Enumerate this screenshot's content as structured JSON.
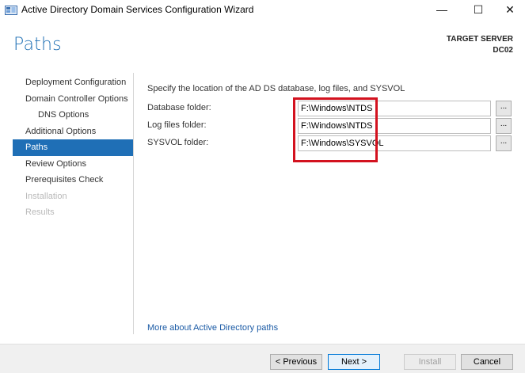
{
  "window": {
    "title": "Active Directory Domain Services Configuration Wizard",
    "minimize": "—",
    "maximize": "☐",
    "close": "✕"
  },
  "header": {
    "page_title": "Paths",
    "target_label": "TARGET SERVER",
    "target_name": "DC02"
  },
  "sidebar": {
    "items": [
      {
        "label": "Deployment Configuration",
        "state": "normal"
      },
      {
        "label": "Domain Controller Options",
        "state": "normal"
      },
      {
        "label": "DNS Options",
        "state": "sub"
      },
      {
        "label": "Additional Options",
        "state": "normal"
      },
      {
        "label": "Paths",
        "state": "active"
      },
      {
        "label": "Review Options",
        "state": "normal"
      },
      {
        "label": "Prerequisites Check",
        "state": "normal"
      },
      {
        "label": "Installation",
        "state": "disabled"
      },
      {
        "label": "Results",
        "state": "disabled"
      }
    ]
  },
  "main": {
    "intro": "Specify the location of the AD DS database, log files, and SYSVOL",
    "fields": [
      {
        "label": "Database folder:",
        "value": "F:\\Windows\\NTDS",
        "browse": "..."
      },
      {
        "label": "Log files folder:",
        "value": "F:\\Windows\\NTDS",
        "browse": "..."
      },
      {
        "label": "SYSVOL folder:",
        "value": "F:\\Windows\\SYSVOL",
        "browse": "..."
      }
    ],
    "more_link": "More about Active Directory paths"
  },
  "footer": {
    "previous": "< Previous",
    "next": "Next >",
    "install": "Install",
    "cancel": "Cancel"
  },
  "colors": {
    "accent": "#1f6fb6",
    "title_blue": "#1e6fb4",
    "highlight_red": "#d3121f"
  }
}
